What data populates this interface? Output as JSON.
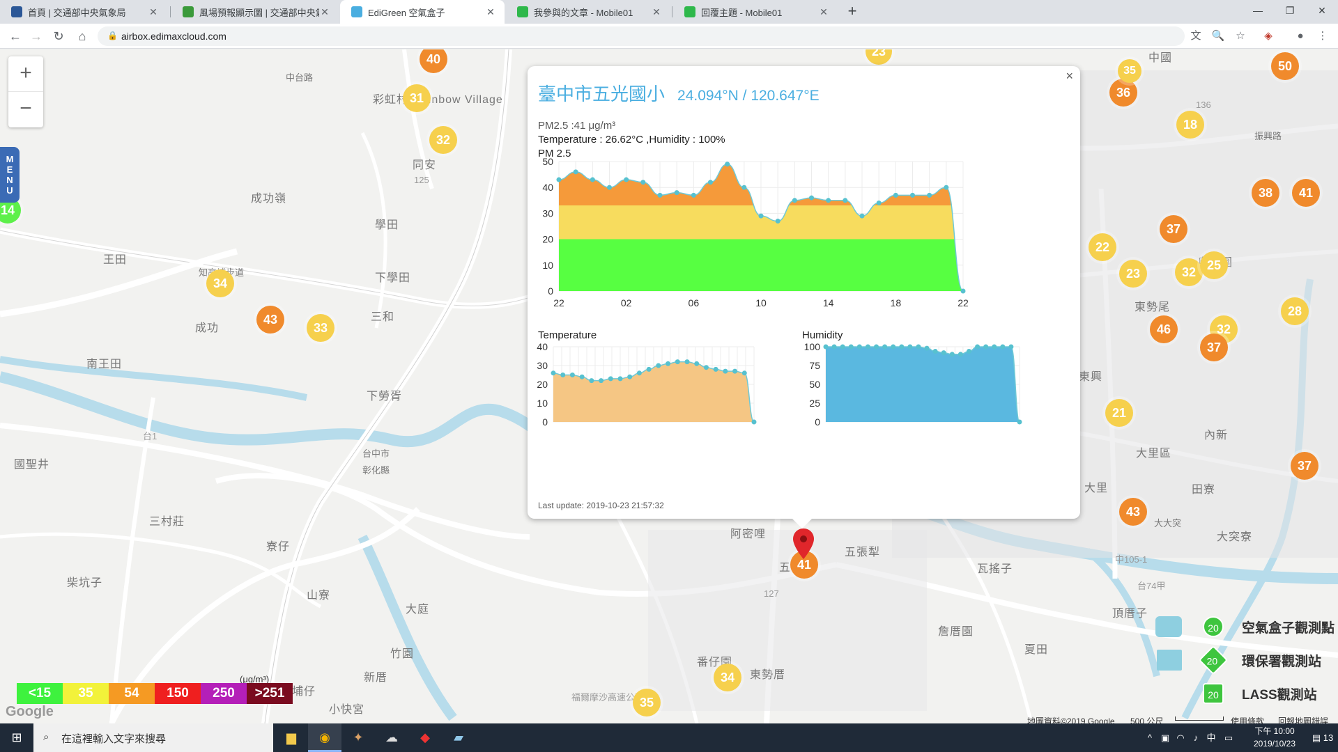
{
  "browser": {
    "tabs": [
      {
        "title": "首頁 | 交通部中央氣象局",
        "active": false
      },
      {
        "title": "風場預報顯示圖 | 交通部中央氣象局",
        "active": false
      },
      {
        "title": "EdiGreen 空氣盒子",
        "active": true
      },
      {
        "title": "我參與的文章 - Mobile01",
        "active": false
      },
      {
        "title": "回覆主題 - Mobile01",
        "active": false
      }
    ],
    "url": "airbox.edimaxcloud.com"
  },
  "map": {
    "zoom_in": "+",
    "zoom_out": "−",
    "menu_label": [
      "M",
      "E",
      "N",
      "U"
    ],
    "place_labels": [
      "中台路",
      "彩虹村-Rainbow Village",
      "成功嶺",
      "王田",
      "學田",
      "知高埔步道",
      "下學田",
      "三和",
      "成功",
      "南王田",
      "下勞胥",
      "國聖井",
      "三村莊",
      "寮仔",
      "柴坑子",
      "山寮",
      "大庭",
      "竹園",
      "新厝",
      "牛埔仔",
      "小快宮",
      "番仔園",
      "東勢厝",
      "阿密哩",
      "五張犁",
      "瓦搖子",
      "詹厝園",
      "夏田",
      "頂厝子",
      "大里區",
      "田寮",
      "大突寮",
      "東勢尾",
      "烏竹圍",
      "內新",
      "振興路",
      "中國",
      "同安",
      "東興",
      "大大突",
      "台中市",
      "彰化縣",
      "大里",
      "五"
    ],
    "road_labels": [
      "台74甲",
      "台1",
      "福爾摩沙高速公路",
      "中105-1",
      "125",
      "136",
      "127"
    ],
    "markers": [
      {
        "value": "40",
        "level": "orange"
      },
      {
        "value": "31",
        "level": "yellow"
      },
      {
        "value": "32",
        "level": "yellow"
      },
      {
        "value": "14",
        "level": "green"
      },
      {
        "value": "34",
        "level": "yellow"
      },
      {
        "value": "43",
        "level": "orange"
      },
      {
        "value": "33",
        "level": "yellow"
      },
      {
        "value": "23",
        "level": "yellow"
      },
      {
        "value": "50",
        "level": "orange"
      },
      {
        "value": "36",
        "level": "orange"
      },
      {
        "value": "35",
        "level": "yellow"
      },
      {
        "value": "18",
        "level": "yellow"
      },
      {
        "value": "38",
        "level": "orange"
      },
      {
        "value": "41",
        "level": "orange"
      },
      {
        "value": "37",
        "level": "orange"
      },
      {
        "value": "22",
        "level": "yellow"
      },
      {
        "value": "23",
        "level": "yellow"
      },
      {
        "value": "32",
        "level": "yellow"
      },
      {
        "value": "25",
        "level": "yellow"
      },
      {
        "value": "28",
        "level": "yellow"
      },
      {
        "value": "46",
        "level": "orange"
      },
      {
        "value": "32",
        "level": "yellow"
      },
      {
        "value": "37",
        "level": "orange"
      },
      {
        "value": "21",
        "level": "yellow"
      },
      {
        "value": "37",
        "level": "orange"
      },
      {
        "value": "43",
        "level": "orange"
      },
      {
        "value": "41",
        "level": "orange"
      },
      {
        "value": "34",
        "level": "yellow"
      },
      {
        "value": "35",
        "level": "yellow"
      }
    ],
    "legend": {
      "unit": "(μg/m³)",
      "items": [
        {
          "label": "<15",
          "color": "#3ef23e"
        },
        {
          "label": "35",
          "color": "#f2f23a"
        },
        {
          "label": "54",
          "color": "#f59a23"
        },
        {
          "label": "150",
          "color": "#ef1f1f"
        },
        {
          "label": "250",
          "color": "#b41fb8"
        },
        {
          "label": ">251",
          "color": "#7a0b1f"
        }
      ]
    },
    "station_legend": [
      {
        "value": "20",
        "label": "空氣盒子觀測點"
      },
      {
        "value": "20",
        "label": "環保署觀測站"
      },
      {
        "value": "20",
        "label": "LASS觀測站"
      }
    ],
    "google_logo": "Google",
    "attribution": "地圖資料©2019 Google",
    "scale": "500 公尺",
    "terms": "使用條款",
    "report": "回報地圖錯誤"
  },
  "popup": {
    "station": "臺中市五光國小",
    "coords": "24.094°N / 120.647°E",
    "pm25_reading": "PM2.5 :41 μg/m³",
    "temp_humidity": "Temperature : 26.62°C ,Humidity : 100%",
    "pm_title": "PM 2.5",
    "temp_title": "Temperature",
    "humidity_title": "Humidity",
    "last_update": "Last update: 2019-10-23 21:57:32",
    "close": "×"
  },
  "chart_data": [
    {
      "type": "area",
      "title": "PM 2.5",
      "x_ticks": [
        "22",
        "02",
        "06",
        "10",
        "14",
        "18",
        "22"
      ],
      "ylim": [
        0,
        50
      ],
      "y_ticks": [
        0,
        10,
        20,
        30,
        40,
        50
      ],
      "values": [
        43,
        46,
        43,
        40,
        43,
        42,
        37,
        38,
        37,
        42,
        49,
        40,
        29,
        27,
        35,
        36,
        35,
        35,
        29,
        34,
        37,
        37,
        37,
        40,
        0
      ],
      "bands": [
        {
          "to": 20,
          "color": "#57ff41"
        },
        {
          "to": 33,
          "color": "#f7dc5e"
        },
        {
          "to": 50,
          "color": "#f59a3a"
        }
      ]
    },
    {
      "type": "area",
      "title": "Temperature",
      "ylim": [
        0,
        40
      ],
      "y_ticks": [
        0,
        10,
        20,
        30,
        40
      ],
      "values": [
        26,
        25,
        25,
        24,
        22,
        22,
        23,
        23,
        24,
        26,
        28,
        30,
        31,
        32,
        32,
        31,
        29,
        28,
        27,
        27,
        26,
        0
      ],
      "color": "#f5c684"
    },
    {
      "type": "area",
      "title": "Humidity",
      "ylim": [
        0,
        100
      ],
      "y_ticks": [
        0,
        25,
        50,
        75,
        100
      ],
      "values": [
        100,
        100,
        100,
        100,
        100,
        100,
        100,
        100,
        100,
        100,
        100,
        100,
        98,
        94,
        92,
        90,
        90,
        94,
        100,
        100,
        100,
        100,
        100,
        0
      ],
      "color": "#5ab8e0"
    }
  ],
  "taskbar": {
    "search_placeholder": "在這裡輸入文字來搜尋",
    "ime": "中",
    "time": "下午 10:00",
    "date": "2019/10/23",
    "notifications": "13"
  }
}
